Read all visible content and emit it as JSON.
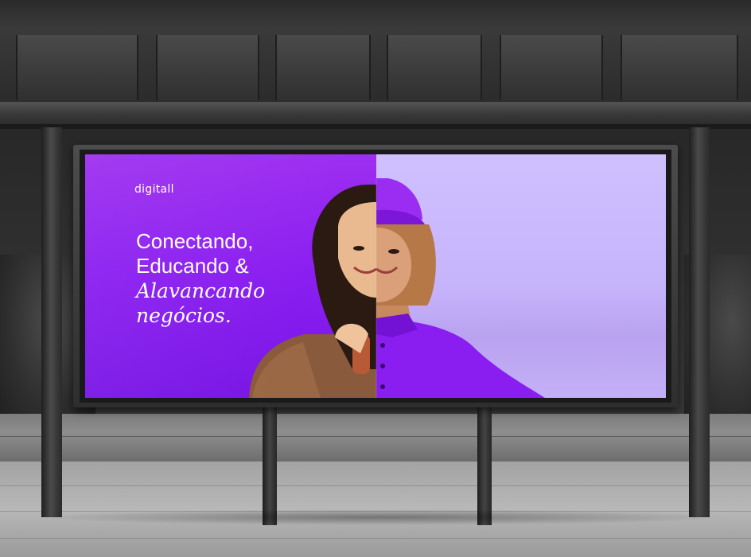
{
  "ad": {
    "brand_logo": "digitall",
    "headline_line1": "Conectando,",
    "headline_line2": "Educando &",
    "headline_line3": "Alavancando",
    "headline_line4": "negócios."
  },
  "colors": {
    "brand_purple": "#8a1ef0",
    "light_lavender": "#c8b6fc",
    "shelter_gray": "#2e2e2e"
  }
}
